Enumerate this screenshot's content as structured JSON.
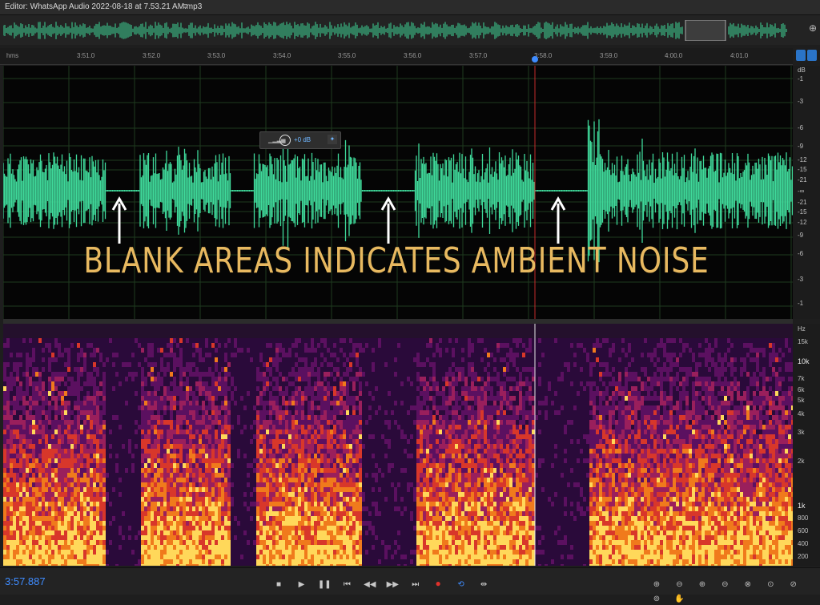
{
  "editor": {
    "title": "Editor: WhatsApp Audio 2022-08-18 at 7.53.21 AM.mp3",
    "menu_icon": "≡"
  },
  "overview": {
    "tools_icon": "zoom-navigator-icon"
  },
  "ruler": {
    "unit": "hms",
    "ticks": [
      "3:51.0",
      "3:52.0",
      "3:53.0",
      "3:54.0",
      "3:55.0",
      "3:56.0",
      "3:57.0",
      "3:58.0",
      "3:59.0",
      "4:00.0",
      "4:01.0"
    ]
  },
  "waveform": {
    "db_unit": "dB",
    "db_labels": [
      "-1",
      "-3",
      "-6",
      "-9",
      "-12",
      "-15",
      "-21",
      "-∞",
      "-21",
      "-15",
      "-12",
      "-9",
      "-6",
      "-3",
      "-1"
    ],
    "hud_value": "+0 dB",
    "annotation": "BLANK AREAS INDICATES AMBIENT NOISE"
  },
  "spectral": {
    "unit": "Hz",
    "labels": [
      "15k",
      "10k",
      "7k",
      "6k",
      "5k",
      "4k",
      "3k",
      "2k",
      "1k",
      "800",
      "600",
      "400",
      "200"
    ]
  },
  "statusbar": {
    "current_time": "3:57.887"
  },
  "colors": {
    "waveform": "#3fd99a",
    "caption": "#e8b960",
    "accent": "#3f8cff",
    "playhead": "#c42a2a",
    "record": "#e0312b"
  }
}
